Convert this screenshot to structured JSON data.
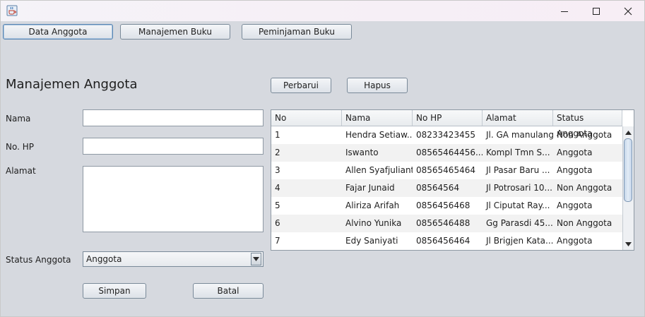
{
  "window": {
    "title": ""
  },
  "nav": {
    "data_anggota": "Data Anggota",
    "manajemen_buku": "Manajemen Buku",
    "peminjaman_buku": "Peminjaman Buku"
  },
  "form": {
    "title": "Manajemen Anggota",
    "nama_label": "Nama",
    "nama_value": "",
    "hp_label": "No. HP",
    "hp_value": "",
    "alamat_label": "Alamat",
    "alamat_value": "",
    "status_label": "Status Anggota",
    "status_value": "Anggota",
    "simpan": "Simpan",
    "batal": "Batal"
  },
  "actions": {
    "perbarui": "Perbarui",
    "hapus": "Hapus"
  },
  "table": {
    "headers": [
      "No",
      "Nama",
      "No HP",
      "Alamat",
      "Status Anggota"
    ],
    "rows": [
      [
        "1",
        "Hendra Setiaw...",
        "08233423455",
        "Jl. GA manulang",
        "Non Anggota"
      ],
      [
        "2",
        "Iswanto",
        "08565464456...",
        "Kompl Tmn S...",
        "Anggota"
      ],
      [
        "3",
        "Allen Syafjulianti",
        "08565465464",
        "Jl Pasar Baru ...",
        "Anggota"
      ],
      [
        "4",
        "Fajar Junaid",
        "08564564",
        "Jl Potrosari 10...",
        "Non Anggota"
      ],
      [
        "5",
        "Aliriza Arifah",
        "0856456468",
        "Jl Ciputat Ray...",
        "Anggota"
      ],
      [
        "6",
        "Alvino Yunika",
        "0856546488",
        "Gg Parasdi 45...",
        "Non Anggota"
      ],
      [
        "7",
        "Edy Saniyati",
        "0856456464",
        "Jl Brigjen Kata...",
        "Anggota"
      ]
    ]
  },
  "icons": {
    "app": "java-cup-icon",
    "minimize": "minimize-icon",
    "maximize": "maximize-icon",
    "close": "close-icon",
    "combo_arrow": "chevron-down-icon"
  },
  "colors": {
    "background": "#d6d9df",
    "titlebar": "#f5f2f7",
    "accent": "#5a86b3"
  }
}
